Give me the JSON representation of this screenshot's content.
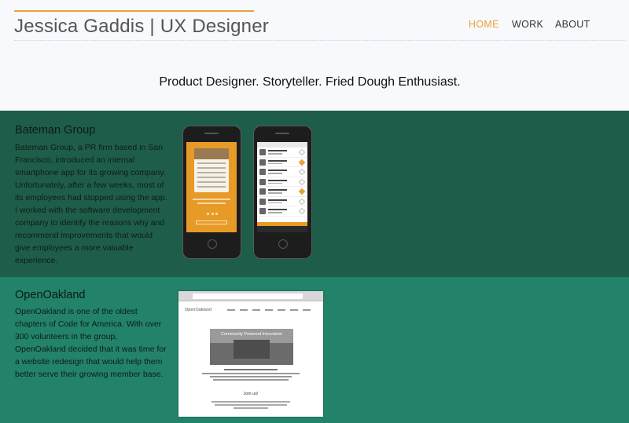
{
  "header": {
    "brand": "Jessica Gaddis | UX Designer",
    "nav": [
      {
        "label": "HOME",
        "active": true
      },
      {
        "label": "WORK",
        "active": false
      },
      {
        "label": "ABOUT",
        "active": false
      }
    ]
  },
  "tagline": "Product Designer. Storyteller. Fried Dough Enthusiast.",
  "projects": [
    {
      "title": "Bateman Group",
      "description": "Bateman Group, a PR firm based in San Francisco, introduced an internal smartphone app for its growing company. Unfortunately, after a few weeks, most of its employees had stopped using the app. I worked with the software development company to identify the reasons why and recommend improvements that would give employees a more valuable experience."
    },
    {
      "title": "OpenOakland",
      "description": "OpenOakland is one of the oldest chapters of Code for America. With over 300 volunteers in the group, OpenOakland decided that it was time for a website redesign that would help them better serve their growing member base.",
      "preview": {
        "logo": "OpenOakland",
        "hero_caption": "Community Powered Innovation",
        "join": "Join us!"
      }
    }
  ],
  "colors": {
    "accent": "#e8a23a",
    "page_bg": "#f8f9fc",
    "bateman_bg": "#1e5d4a",
    "oakland_bg": "#22826a"
  }
}
